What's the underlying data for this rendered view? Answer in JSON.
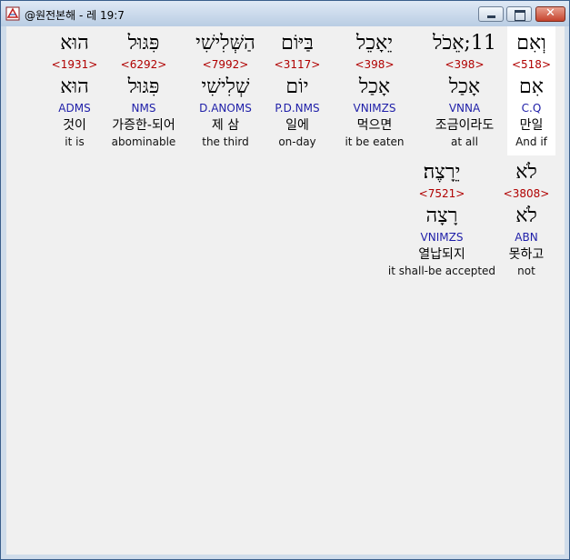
{
  "window": {
    "title": "@원전본해 - 레 19:7",
    "close_label": "✕"
  },
  "rows": [
    [
      {
        "hebrew": "הוּא",
        "strong": "<1931>",
        "lemma": "הוּא",
        "morph": "ADMS",
        "korean": "것이",
        "english": "it is"
      },
      {
        "hebrew": "פִּגּוּל",
        "strong": "<6292>",
        "lemma": "פִּגּוּל",
        "morph": "NMS",
        "korean": "가증한-되어",
        "english": "abominable"
      },
      {
        "hebrew": "הַשְּׁלִישִׁי",
        "strong": "<7992>",
        "lemma": "שְׁלִישִׁי",
        "morph": "D.ANOMS",
        "korean": "제 삼",
        "english": "the third"
      },
      {
        "hebrew": "בַּיּוֹם",
        "strong": "<3117>",
        "lemma": "יוֹם",
        "morph": "P.D.NMS",
        "korean": "일에",
        "english": "on-day"
      },
      {
        "hebrew": "יֵאָכֵל",
        "strong": "<398>",
        "lemma": "אָכַל",
        "morph": "VNIMZS",
        "korean": "먹으면",
        "english": "it be eaten"
      },
      {
        "hebrew": "11;אֵכֹל",
        "strong": "<398>",
        "lemma": "אָכַל",
        "morph": "VNNA",
        "korean": "조금이라도",
        "english": "at all"
      },
      {
        "hebrew": "וְאִם",
        "strong": "<518>",
        "lemma": "אִם",
        "morph": "C.Q",
        "korean": "만일",
        "english": "And if"
      }
    ],
    [
      {
        "hebrew": "יֵרָצֶה׃",
        "strong": "<7521>",
        "lemma": "רָצָה",
        "morph": "VNIMZS",
        "korean": "열납되지",
        "english": "it shall-be accepted"
      },
      {
        "hebrew": "לֹא",
        "strong": "<3808>",
        "lemma": "לֹא",
        "morph": "ABN",
        "korean": "못하고",
        "english": "not"
      }
    ]
  ]
}
